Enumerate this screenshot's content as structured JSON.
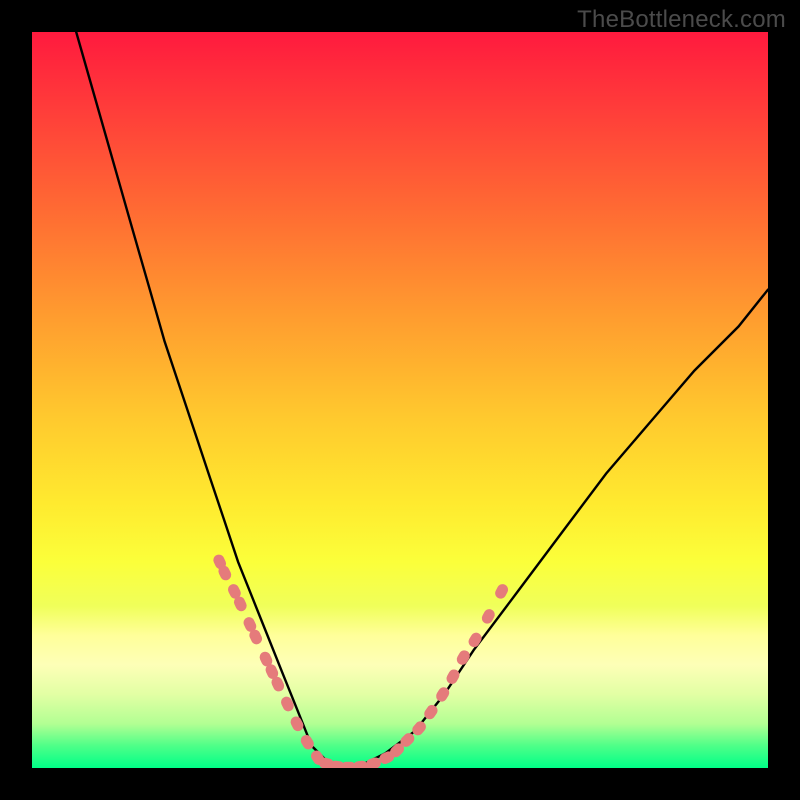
{
  "watermark": "TheBottleneck.com",
  "colors": {
    "background": "#000000",
    "curve": "#000000",
    "marker": "#e57b7b",
    "gradient_top": "#ff1a3e",
    "gradient_bottom": "#00ff87"
  },
  "chart_data": {
    "type": "line",
    "title": "",
    "xlabel": "",
    "ylabel": "",
    "xlim": [
      0,
      100
    ],
    "ylim": [
      0,
      100
    ],
    "note": "Axes are unlabeled; values are estimated from pixel positions on a 0–100 normalized scale. y=0 is the valley floor (green), y=100 is the top (red). Left branch descends steeply from top-left toward the valley near x≈38; right branch rises from the valley toward the right edge near y≈65.",
    "series": [
      {
        "name": "curve",
        "x": [
          6,
          8,
          10,
          12,
          14,
          16,
          18,
          20,
          22,
          24,
          26,
          28,
          30,
          32,
          34,
          36,
          38,
          40,
          42,
          44,
          46,
          48,
          52,
          56,
          60,
          66,
          72,
          78,
          84,
          90,
          96,
          100
        ],
        "y": [
          100,
          93,
          86,
          79,
          72,
          65,
          58,
          52,
          46,
          40,
          34,
          28,
          23,
          18,
          13,
          8,
          3,
          1,
          0,
          0,
          1,
          2,
          5,
          10,
          16,
          24,
          32,
          40,
          47,
          54,
          60,
          65
        ]
      },
      {
        "name": "markers-left",
        "x": [
          25.5,
          26.2,
          27.5,
          28.3,
          29.6,
          30.4,
          31.8,
          32.6,
          33.4,
          34.7,
          36.0,
          37.4,
          38.8
        ],
        "y": [
          28.0,
          26.5,
          24.0,
          22.3,
          19.5,
          17.8,
          14.8,
          13.1,
          11.4,
          8.7,
          6.0,
          3.5,
          1.4
        ]
      },
      {
        "name": "markers-bottom",
        "x": [
          40.0,
          41.5,
          43.0,
          44.6,
          46.4,
          48.2
        ],
        "y": [
          0.6,
          0.2,
          0.1,
          0.2,
          0.6,
          1.4
        ]
      },
      {
        "name": "markers-right",
        "x": [
          49.6,
          51.0,
          52.6,
          54.2,
          55.8,
          57.2,
          58.6,
          60.2,
          62.0,
          63.8
        ],
        "y": [
          2.4,
          3.8,
          5.4,
          7.6,
          10.0,
          12.4,
          15.0,
          17.4,
          20.6,
          24.0
        ]
      }
    ]
  }
}
